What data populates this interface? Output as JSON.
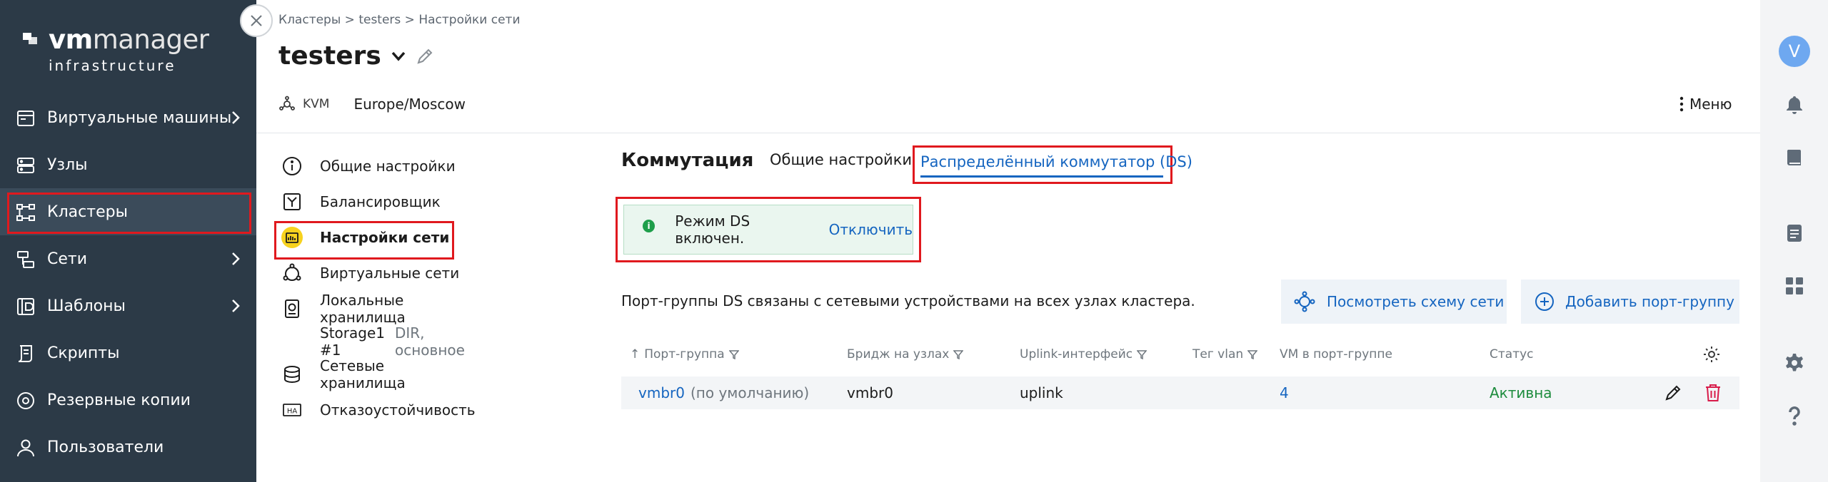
{
  "logo": {
    "word_bold": "vm",
    "word_rest": "manager",
    "sub": "infrastructure"
  },
  "sidebar": {
    "items": [
      {
        "label": "Виртуальные машины",
        "icon": "vm-icon",
        "has_children": true
      },
      {
        "label": "Узлы",
        "icon": "server-icon",
        "has_children": false
      },
      {
        "label": "Кластеры",
        "icon": "cluster-icon",
        "has_children": false,
        "active": true
      },
      {
        "label": "Сети",
        "icon": "network-icon",
        "has_children": true
      },
      {
        "label": "Шаблоны",
        "icon": "template-icon",
        "has_children": true
      },
      {
        "label": "Скрипты",
        "icon": "script-icon",
        "has_children": false
      },
      {
        "label": "Резервные копии",
        "icon": "backup-icon",
        "has_children": false
      },
      {
        "label": "Пользователи",
        "icon": "user-icon",
        "has_children": false
      }
    ]
  },
  "breadcrumb": {
    "text": "Кластеры > testers > Настройки сети"
  },
  "header": {
    "title": "testers",
    "kvm": "KVM",
    "timezone": "Europe/Moscow",
    "menu_label": "Меню"
  },
  "subnav": {
    "items": [
      {
        "label": "Общие настройки"
      },
      {
        "label": "Балансировщик"
      },
      {
        "label": "Настройки сети",
        "active": true
      },
      {
        "label": "Виртуальные сети"
      },
      {
        "label": "Локальные хранилища"
      }
    ],
    "storage_child": {
      "name": "Storage1 #1",
      "detail": "DIR, основное"
    },
    "items_after": [
      {
        "label": "Сетевые хранилища"
      },
      {
        "label": "Отказоустойчивость"
      }
    ]
  },
  "content": {
    "section_title": "Коммутация",
    "tab_general": "Общие настройки",
    "tab_ds": "Распределённый коммутатор (DS)",
    "alert_text": "Режим DS включен.",
    "alert_link": "Отключить",
    "description": "Порт-группы DS связаны с сетевыми устройствами на всех узлах кластера.",
    "btn_schema": "Посмотреть схему сети",
    "btn_add": "Добавить порт-группу"
  },
  "table": {
    "columns": [
      "Порт-группа",
      "Бридж на узлах",
      "Uplink-интерфейс",
      "Тег vlan",
      "VM в порт-группе",
      "Статус"
    ],
    "rows": [
      {
        "port_group": "vmbr0",
        "default_note": "(по умолчанию)",
        "bridge": "vmbr0",
        "uplink": "uplink",
        "vlan": "",
        "vm_count": "4",
        "status": "Активна"
      }
    ]
  },
  "rail": {
    "avatar_letter": "V"
  },
  "colors": {
    "sidebar_bg": "#2c3a47",
    "accent": "#1565c0",
    "highlight": "#e0191e",
    "success": "#1e8c3e"
  }
}
